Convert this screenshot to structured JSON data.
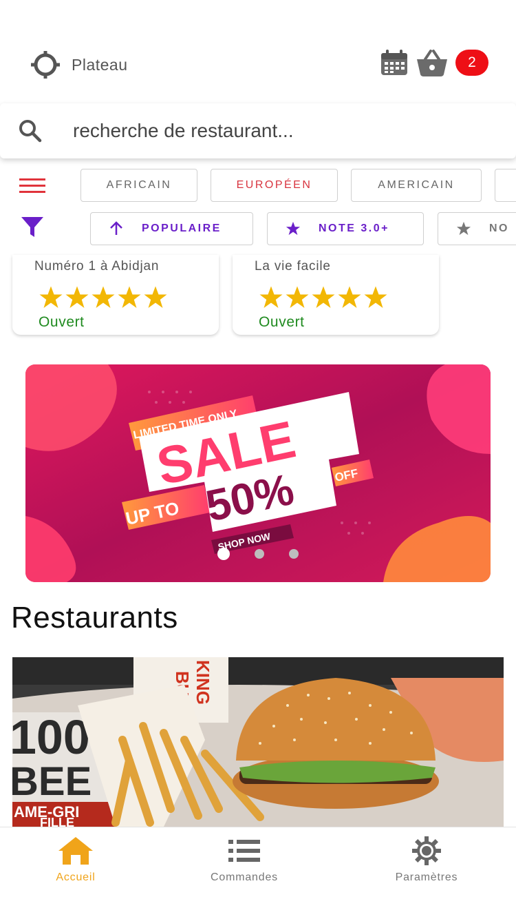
{
  "header": {
    "location": "Plateau",
    "cart_count": "2"
  },
  "search": {
    "placeholder": "recherche de restaurant..."
  },
  "categories": [
    "AFRICAIN",
    "EUROPÉEN",
    "AMERICAIN"
  ],
  "active_category": "EUROPÉEN",
  "sort_filters": [
    "POPULAIRE",
    "NOTE 3.0+",
    "NO"
  ],
  "featured": [
    {
      "subtitle": "Numéro 1 à Abidjan",
      "rating": 5,
      "status": "Ouvert"
    },
    {
      "subtitle": "La vie facile",
      "rating": 5,
      "status": "Ouvert"
    }
  ],
  "banner": {
    "line1": "LIMITED TIME ONLY",
    "line2": "SALE",
    "line3a": "UP TO",
    "line3b": "50%",
    "line3c": "OFF",
    "cta": "SHOP NOW",
    "slide_count": 3,
    "active_slide": 1
  },
  "section_title": "Restaurants",
  "food_image": {
    "text1": "BURG",
    "text2": "KING",
    "text3": "100",
    "text4": "BEE",
    "text5": "AME-GRI",
    "text6": "FILLE"
  },
  "bottom_nav": [
    {
      "label": "Accueil",
      "icon": "home-icon",
      "active": true
    },
    {
      "label": "Commandes",
      "icon": "list-icon",
      "active": false
    },
    {
      "label": "Paramètres",
      "icon": "gear-icon",
      "active": false
    }
  ],
  "colors": {
    "accent_red": "#ee0f16",
    "purple": "#6a1fc9",
    "star": "#f2b705",
    "open_green": "#1f8a1f",
    "nav_active": "#f0a41a"
  }
}
